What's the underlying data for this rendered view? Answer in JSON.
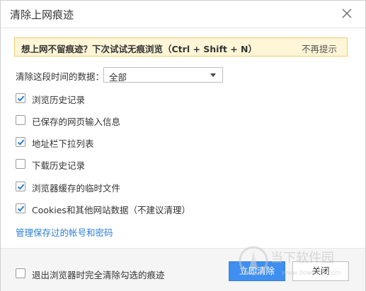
{
  "dialog": {
    "title": "清除上网痕迹",
    "close_icon": "close-icon"
  },
  "notice": {
    "text": "想上网不留痕迹？下次试试无痕浏览（Ctrl + Shift + N）",
    "dismiss_label": "不再提示"
  },
  "time_range": {
    "label": "清除这段时间的数据：",
    "selected": "全部"
  },
  "options": [
    {
      "label": "浏览历史记录",
      "checked": true
    },
    {
      "label": "已保存的网页输入信息",
      "checked": false
    },
    {
      "label": "地址栏下拉列表",
      "checked": true
    },
    {
      "label": "下载历史记录",
      "checked": false
    },
    {
      "label": "浏览器缓存的临时文件",
      "checked": true
    },
    {
      "label": "Cookies和其他网站数据（不建议清理）",
      "checked": true
    }
  ],
  "manage_link": "管理保存过的帐号和密码",
  "footer": {
    "exit_clear_label": "退出浏览器时完全清除勾选的痕迹",
    "exit_clear_checked": false,
    "clear_now_label": "立即清除",
    "close_label": "关闭"
  },
  "watermark": {
    "text": "当下软件园",
    "url": "www.downxia.com"
  },
  "colors": {
    "accent": "#3e8ff0",
    "link": "#2c7ed6",
    "notice_bg": "#fff6d8",
    "notice_border": "#f1c96a"
  }
}
